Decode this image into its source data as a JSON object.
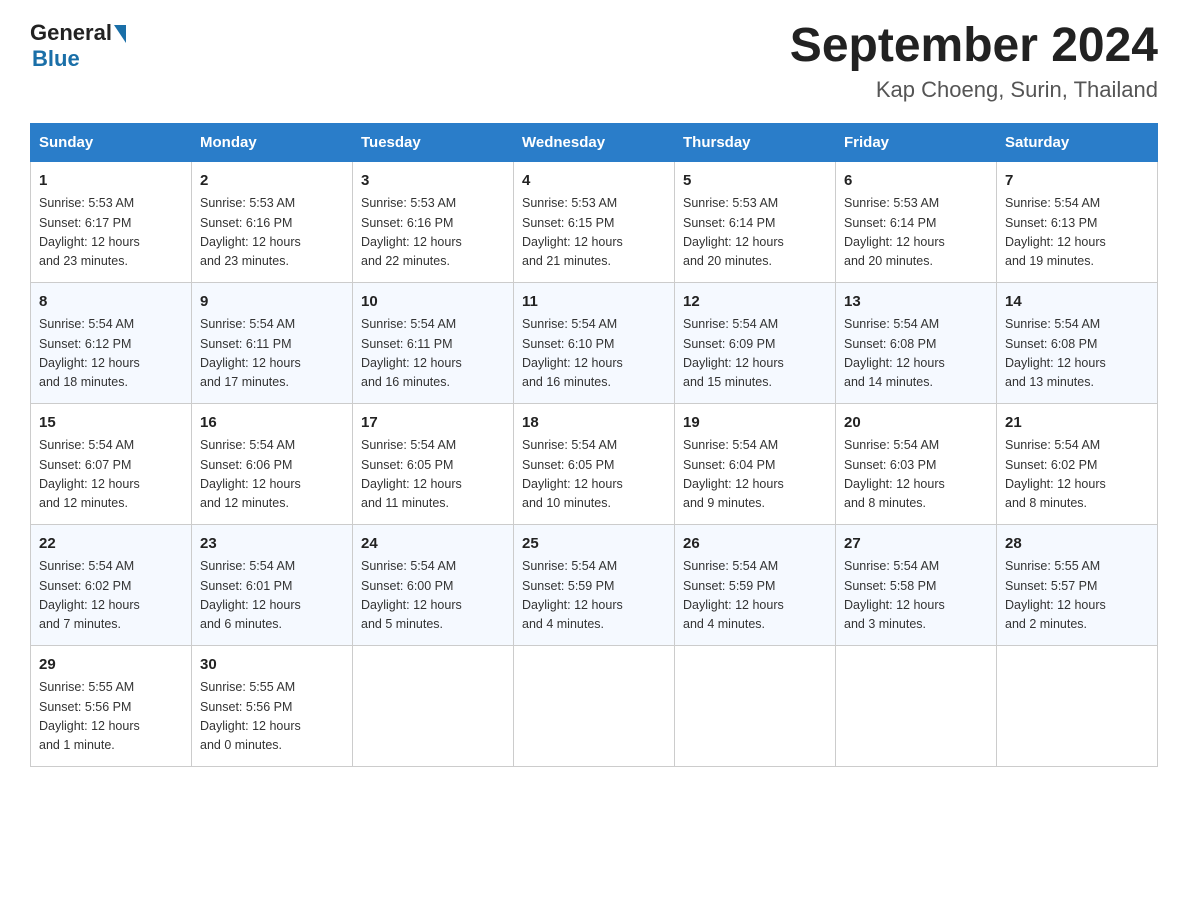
{
  "header": {
    "logo_general": "General",
    "logo_blue": "Blue",
    "title": "September 2024",
    "subtitle": "Kap Choeng, Surin, Thailand"
  },
  "weekdays": [
    "Sunday",
    "Monday",
    "Tuesday",
    "Wednesday",
    "Thursday",
    "Friday",
    "Saturday"
  ],
  "weeks": [
    [
      {
        "day": "1",
        "sunrise": "5:53 AM",
        "sunset": "6:17 PM",
        "daylight": "12 hours and 23 minutes."
      },
      {
        "day": "2",
        "sunrise": "5:53 AM",
        "sunset": "6:16 PM",
        "daylight": "12 hours and 23 minutes."
      },
      {
        "day": "3",
        "sunrise": "5:53 AM",
        "sunset": "6:16 PM",
        "daylight": "12 hours and 22 minutes."
      },
      {
        "day": "4",
        "sunrise": "5:53 AM",
        "sunset": "6:15 PM",
        "daylight": "12 hours and 21 minutes."
      },
      {
        "day": "5",
        "sunrise": "5:53 AM",
        "sunset": "6:14 PM",
        "daylight": "12 hours and 20 minutes."
      },
      {
        "day": "6",
        "sunrise": "5:53 AM",
        "sunset": "6:14 PM",
        "daylight": "12 hours and 20 minutes."
      },
      {
        "day": "7",
        "sunrise": "5:54 AM",
        "sunset": "6:13 PM",
        "daylight": "12 hours and 19 minutes."
      }
    ],
    [
      {
        "day": "8",
        "sunrise": "5:54 AM",
        "sunset": "6:12 PM",
        "daylight": "12 hours and 18 minutes."
      },
      {
        "day": "9",
        "sunrise": "5:54 AM",
        "sunset": "6:11 PM",
        "daylight": "12 hours and 17 minutes."
      },
      {
        "day": "10",
        "sunrise": "5:54 AM",
        "sunset": "6:11 PM",
        "daylight": "12 hours and 16 minutes."
      },
      {
        "day": "11",
        "sunrise": "5:54 AM",
        "sunset": "6:10 PM",
        "daylight": "12 hours and 16 minutes."
      },
      {
        "day": "12",
        "sunrise": "5:54 AM",
        "sunset": "6:09 PM",
        "daylight": "12 hours and 15 minutes."
      },
      {
        "day": "13",
        "sunrise": "5:54 AM",
        "sunset": "6:08 PM",
        "daylight": "12 hours and 14 minutes."
      },
      {
        "day": "14",
        "sunrise": "5:54 AM",
        "sunset": "6:08 PM",
        "daylight": "12 hours and 13 minutes."
      }
    ],
    [
      {
        "day": "15",
        "sunrise": "5:54 AM",
        "sunset": "6:07 PM",
        "daylight": "12 hours and 12 minutes."
      },
      {
        "day": "16",
        "sunrise": "5:54 AM",
        "sunset": "6:06 PM",
        "daylight": "12 hours and 12 minutes."
      },
      {
        "day": "17",
        "sunrise": "5:54 AM",
        "sunset": "6:05 PM",
        "daylight": "12 hours and 11 minutes."
      },
      {
        "day": "18",
        "sunrise": "5:54 AM",
        "sunset": "6:05 PM",
        "daylight": "12 hours and 10 minutes."
      },
      {
        "day": "19",
        "sunrise": "5:54 AM",
        "sunset": "6:04 PM",
        "daylight": "12 hours and 9 minutes."
      },
      {
        "day": "20",
        "sunrise": "5:54 AM",
        "sunset": "6:03 PM",
        "daylight": "12 hours and 8 minutes."
      },
      {
        "day": "21",
        "sunrise": "5:54 AM",
        "sunset": "6:02 PM",
        "daylight": "12 hours and 8 minutes."
      }
    ],
    [
      {
        "day": "22",
        "sunrise": "5:54 AM",
        "sunset": "6:02 PM",
        "daylight": "12 hours and 7 minutes."
      },
      {
        "day": "23",
        "sunrise": "5:54 AM",
        "sunset": "6:01 PM",
        "daylight": "12 hours and 6 minutes."
      },
      {
        "day": "24",
        "sunrise": "5:54 AM",
        "sunset": "6:00 PM",
        "daylight": "12 hours and 5 minutes."
      },
      {
        "day": "25",
        "sunrise": "5:54 AM",
        "sunset": "5:59 PM",
        "daylight": "12 hours and 4 minutes."
      },
      {
        "day": "26",
        "sunrise": "5:54 AM",
        "sunset": "5:59 PM",
        "daylight": "12 hours and 4 minutes."
      },
      {
        "day": "27",
        "sunrise": "5:54 AM",
        "sunset": "5:58 PM",
        "daylight": "12 hours and 3 minutes."
      },
      {
        "day": "28",
        "sunrise": "5:55 AM",
        "sunset": "5:57 PM",
        "daylight": "12 hours and 2 minutes."
      }
    ],
    [
      {
        "day": "29",
        "sunrise": "5:55 AM",
        "sunset": "5:56 PM",
        "daylight": "12 hours and 1 minute."
      },
      {
        "day": "30",
        "sunrise": "5:55 AM",
        "sunset": "5:56 PM",
        "daylight": "12 hours and 0 minutes."
      },
      null,
      null,
      null,
      null,
      null
    ]
  ],
  "labels": {
    "sunrise": "Sunrise:",
    "sunset": "Sunset:",
    "daylight": "Daylight:"
  }
}
